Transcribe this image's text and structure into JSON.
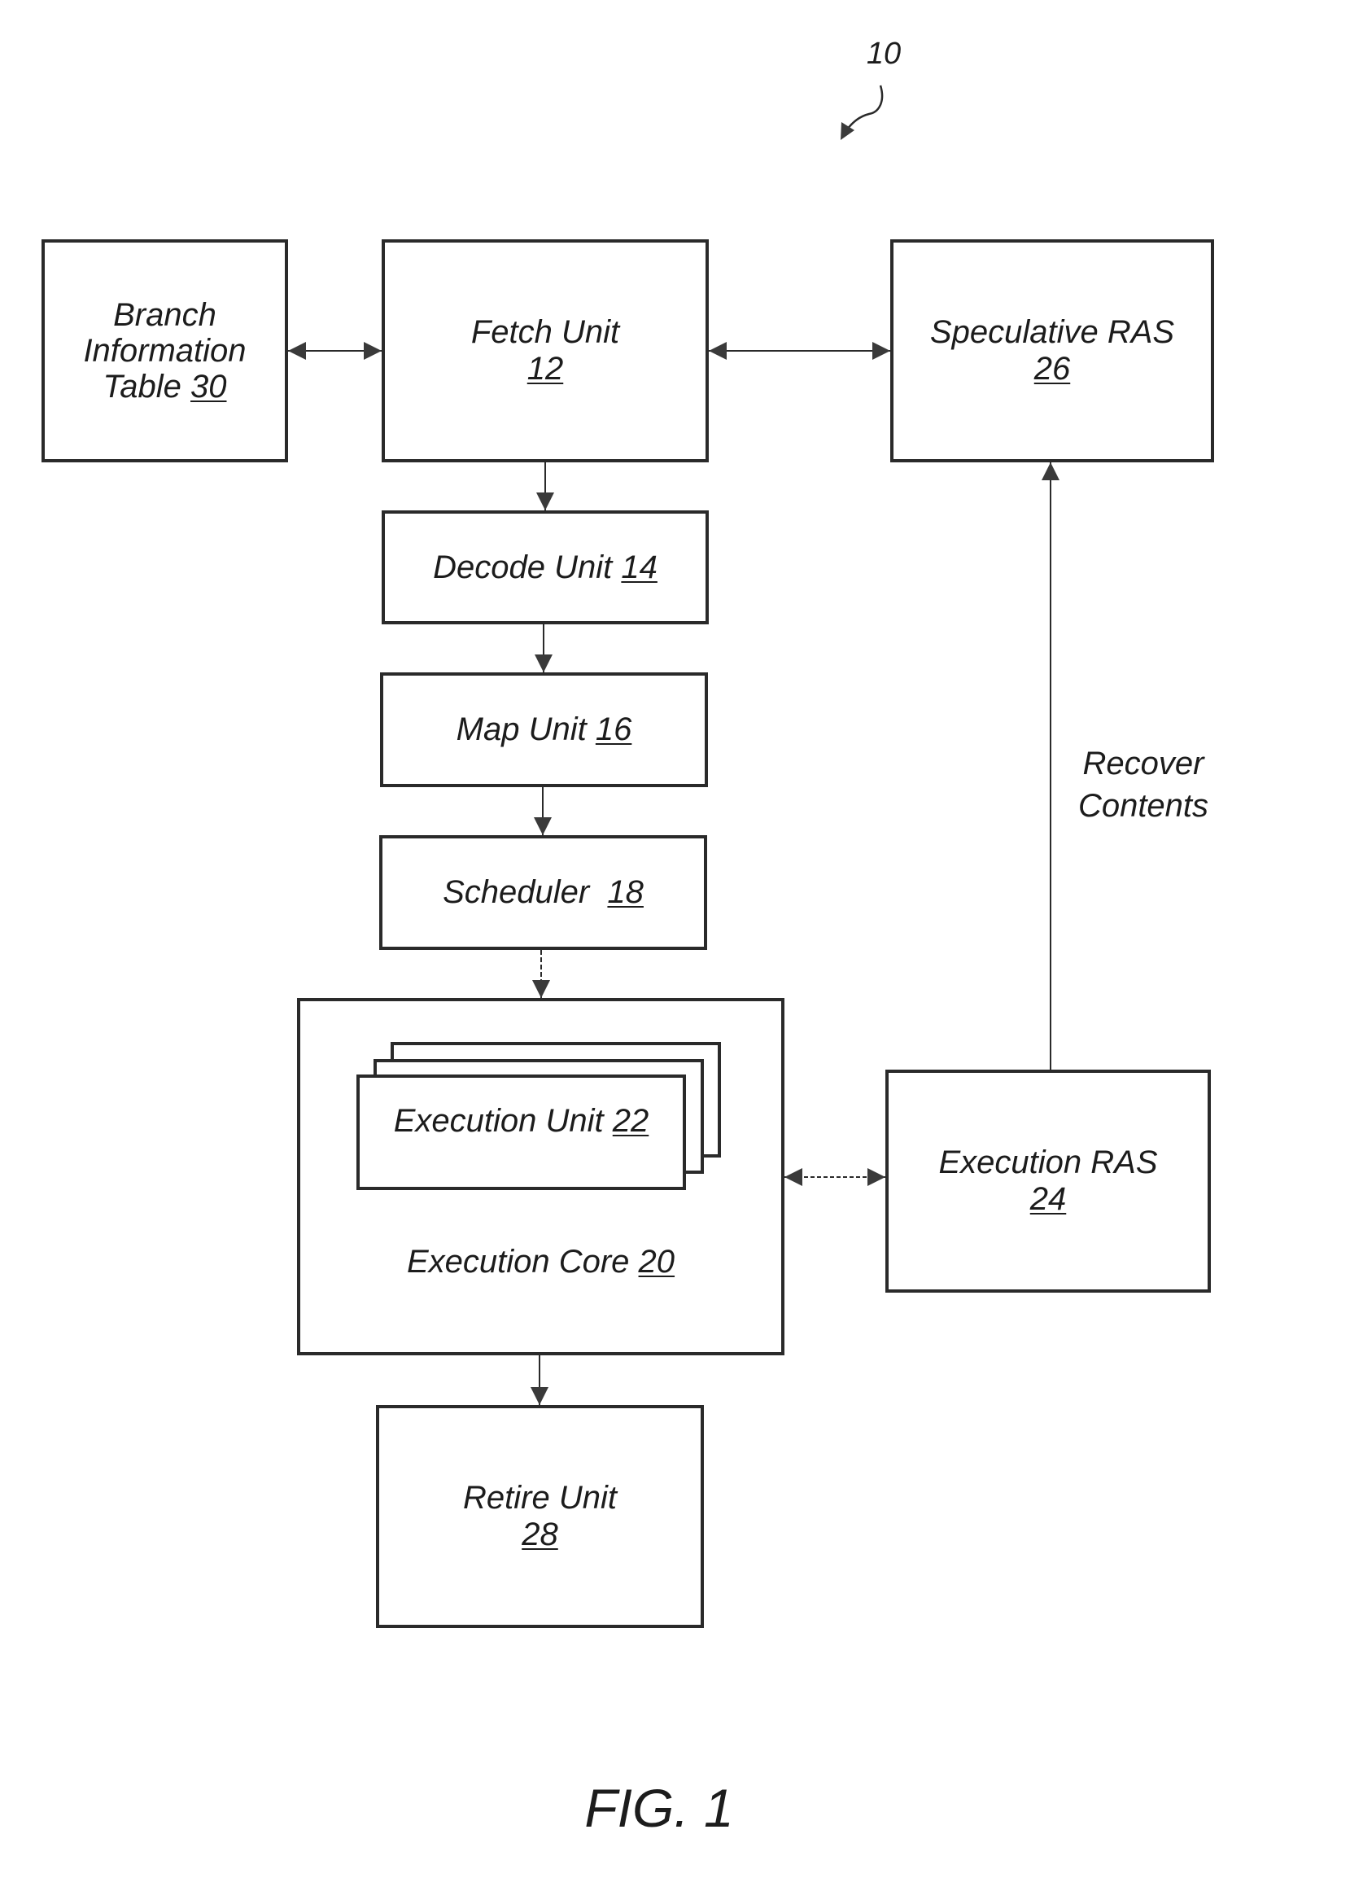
{
  "figure": {
    "reference_number": "10",
    "caption": "FIG. 1"
  },
  "blocks": {
    "branch_info_table": {
      "lines": [
        "Branch",
        "Information",
        "Table"
      ],
      "ref": "30"
    },
    "fetch_unit": {
      "name": "Fetch Unit",
      "ref": "12"
    },
    "speculative_ras": {
      "name": "Speculative RAS",
      "ref": "26"
    },
    "decode_unit": {
      "name": "Decode Unit",
      "ref": "14"
    },
    "map_unit": {
      "name": "Map Unit",
      "ref": "16"
    },
    "scheduler": {
      "name": "Scheduler",
      "ref": "18"
    },
    "execution_unit": {
      "name": "Execution Unit",
      "ref": "22"
    },
    "execution_core": {
      "name": "Execution Core",
      "ref": "20"
    },
    "execution_ras": {
      "name": "Execution RAS",
      "ref": "24"
    },
    "retire_unit": {
      "name": "Retire Unit",
      "ref": "28"
    }
  },
  "connections": [
    {
      "from": "branch_info_table",
      "to": "fetch_unit",
      "type": "bidirectional"
    },
    {
      "from": "fetch_unit",
      "to": "speculative_ras",
      "type": "bidirectional"
    },
    {
      "from": "fetch_unit",
      "to": "decode_unit",
      "type": "directed"
    },
    {
      "from": "decode_unit",
      "to": "map_unit",
      "type": "directed"
    },
    {
      "from": "map_unit",
      "to": "scheduler",
      "type": "directed"
    },
    {
      "from": "scheduler",
      "to": "execution_core",
      "type": "directed"
    },
    {
      "from": "execution_core",
      "to": "execution_ras",
      "type": "bidirectional"
    },
    {
      "from": "execution_core",
      "to": "retire_unit",
      "type": "directed"
    },
    {
      "from": "execution_ras",
      "to": "speculative_ras",
      "type": "directed",
      "label": [
        "Recover",
        "Contents"
      ]
    }
  ],
  "edge_labels": {
    "recover_contents": [
      "Recover",
      "Contents"
    ]
  }
}
